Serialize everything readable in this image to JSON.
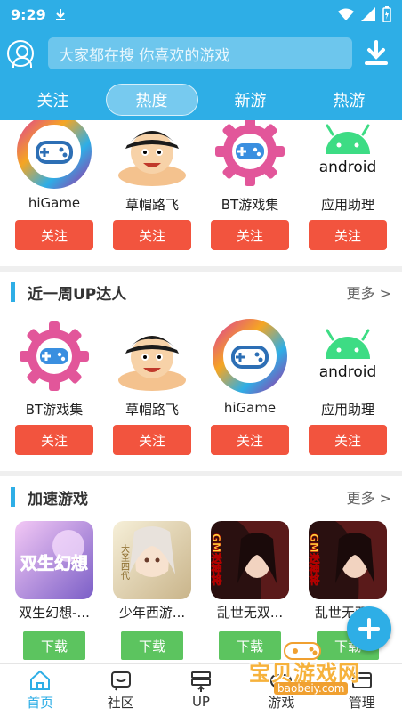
{
  "status": {
    "time": "9:29"
  },
  "search": {
    "placeholder": "大家都在搜  你喜欢的游戏"
  },
  "tabs": [
    {
      "label": "关注"
    },
    {
      "label": "热度"
    },
    {
      "label": "新游"
    },
    {
      "label": "热游"
    }
  ],
  "top_row": [
    {
      "name": "hiGame",
      "icon": "higame-logo-icon",
      "button": "关注"
    },
    {
      "name": "草帽路飞",
      "icon": "luffy-avatar-icon",
      "button": "关注"
    },
    {
      "name": "BT游戏集",
      "icon": "bt-gear-gamepad-icon",
      "button": "关注"
    },
    {
      "name": "应用助理",
      "icon": "android-logo-icon",
      "button": "关注"
    }
  ],
  "up_section": {
    "title": "近一周UP达人",
    "more": "更多 >",
    "items": [
      {
        "name": "BT游戏集",
        "icon": "bt-gear-gamepad-icon",
        "button": "关注"
      },
      {
        "name": "草帽路飞",
        "icon": "luffy-avatar-icon",
        "button": "关注"
      },
      {
        "name": "hiGame",
        "icon": "higame-logo-icon",
        "button": "关注"
      },
      {
        "name": "应用助理",
        "icon": "android-logo-icon",
        "button": "关注"
      }
    ]
  },
  "speed_section": {
    "title": "加速游戏",
    "more": "更多 >",
    "items": [
      {
        "name": "双生幻想-...",
        "art": "双生幻想",
        "button": "下载"
      },
      {
        "name": "少年西游...",
        "art": "大圣四代",
        "button": "下载"
      },
      {
        "name": "乱世无双...",
        "art": "GM送神将",
        "button": "下载"
      },
      {
        "name": "乱世无双...",
        "art": "GM送神将",
        "button": "下载"
      }
    ]
  },
  "bottom_nav": [
    {
      "label": "首页",
      "icon": "home-icon",
      "active": true
    },
    {
      "label": "社区",
      "icon": "community-icon",
      "active": false
    },
    {
      "label": "UP",
      "icon": "up-icon",
      "active": false
    },
    {
      "label": "游戏",
      "icon": "game-icon",
      "active": false
    },
    {
      "label": "管理",
      "icon": "manage-icon",
      "active": false
    }
  ],
  "watermark": {
    "text": "宝贝游戏网",
    "url": "baobeiy.com"
  },
  "colors": {
    "primary": "#2eaee6",
    "follow": "#f2543e",
    "download": "#5cc45f"
  }
}
